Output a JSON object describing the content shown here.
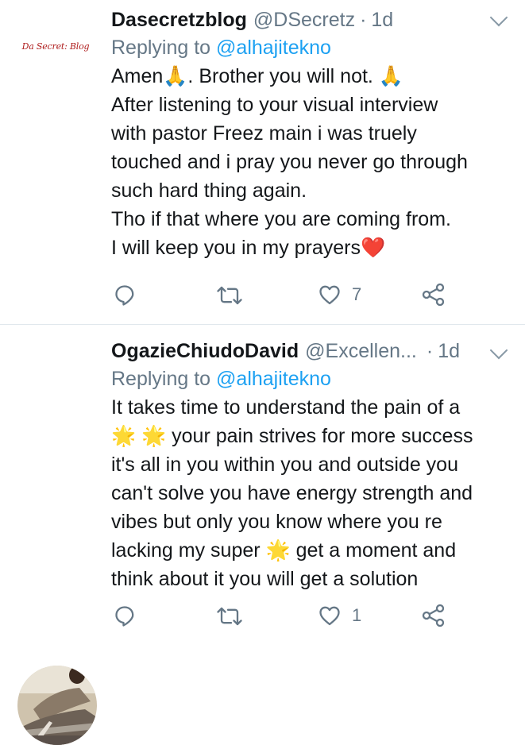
{
  "tweets": [
    {
      "name": "Dasecretzblog",
      "handle": "@DSecretz",
      "dot": "·",
      "time": "1d",
      "avatar_text": "Da Secret: Blog",
      "reply_prefix": "Replying to",
      "reply_to": "@alhajitekno",
      "lines": [
        "Amen🙏. Brother you will not. 🙏",
        "After listening to your visual interview",
        "with pastor Freez main i was truely",
        "touched and i pray you never go through",
        "such hard thing again.",
        "Tho if that where you are coming from.",
        "I will keep you in my prayers❤️"
      ],
      "like_count": "7"
    },
    {
      "name": "OgazieChiudoDavid",
      "handle": "@Excellen...",
      "dot": "·",
      "time": "1d",
      "reply_prefix": "Replying to",
      "reply_to": "@alhajitekno",
      "lines": [
        "It takes time to understand the pain of a",
        "🌟 🌟 your pain strives for more success",
        "it's all in you within you and outside you",
        "can't solve you have energy strength and",
        "vibes but only you know where you re",
        "lacking my super 🌟 get a moment and",
        "think about it you will get a solution"
      ],
      "like_count": "1"
    }
  ],
  "colors": {
    "text": "#14171a",
    "secondary": "#657786",
    "link": "#1da1f2",
    "divider": "#e1e8ed"
  },
  "icons": [
    "reply-icon",
    "retweet-icon",
    "like-icon",
    "share-icon",
    "chevron-down-icon"
  ]
}
